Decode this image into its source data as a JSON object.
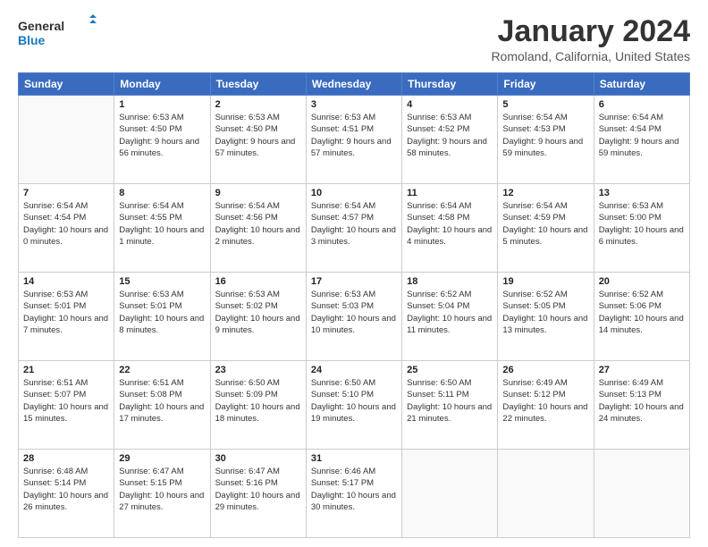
{
  "logo": {
    "general": "General",
    "blue": "Blue"
  },
  "header": {
    "title": "January 2024",
    "subtitle": "Romoland, California, United States"
  },
  "weekdays": [
    "Sunday",
    "Monday",
    "Tuesday",
    "Wednesday",
    "Thursday",
    "Friday",
    "Saturday"
  ],
  "weeks": [
    [
      {
        "day": "",
        "sunrise": "",
        "sunset": "",
        "daylight": ""
      },
      {
        "day": "1",
        "sunrise": "Sunrise: 6:53 AM",
        "sunset": "Sunset: 4:50 PM",
        "daylight": "Daylight: 9 hours and 56 minutes."
      },
      {
        "day": "2",
        "sunrise": "Sunrise: 6:53 AM",
        "sunset": "Sunset: 4:50 PM",
        "daylight": "Daylight: 9 hours and 57 minutes."
      },
      {
        "day": "3",
        "sunrise": "Sunrise: 6:53 AM",
        "sunset": "Sunset: 4:51 PM",
        "daylight": "Daylight: 9 hours and 57 minutes."
      },
      {
        "day": "4",
        "sunrise": "Sunrise: 6:53 AM",
        "sunset": "Sunset: 4:52 PM",
        "daylight": "Daylight: 9 hours and 58 minutes."
      },
      {
        "day": "5",
        "sunrise": "Sunrise: 6:54 AM",
        "sunset": "Sunset: 4:53 PM",
        "daylight": "Daylight: 9 hours and 59 minutes."
      },
      {
        "day": "6",
        "sunrise": "Sunrise: 6:54 AM",
        "sunset": "Sunset: 4:54 PM",
        "daylight": "Daylight: 9 hours and 59 minutes."
      }
    ],
    [
      {
        "day": "7",
        "sunrise": "Sunrise: 6:54 AM",
        "sunset": "Sunset: 4:54 PM",
        "daylight": "Daylight: 10 hours and 0 minutes."
      },
      {
        "day": "8",
        "sunrise": "Sunrise: 6:54 AM",
        "sunset": "Sunset: 4:55 PM",
        "daylight": "Daylight: 10 hours and 1 minute."
      },
      {
        "day": "9",
        "sunrise": "Sunrise: 6:54 AM",
        "sunset": "Sunset: 4:56 PM",
        "daylight": "Daylight: 10 hours and 2 minutes."
      },
      {
        "day": "10",
        "sunrise": "Sunrise: 6:54 AM",
        "sunset": "Sunset: 4:57 PM",
        "daylight": "Daylight: 10 hours and 3 minutes."
      },
      {
        "day": "11",
        "sunrise": "Sunrise: 6:54 AM",
        "sunset": "Sunset: 4:58 PM",
        "daylight": "Daylight: 10 hours and 4 minutes."
      },
      {
        "day": "12",
        "sunrise": "Sunrise: 6:54 AM",
        "sunset": "Sunset: 4:59 PM",
        "daylight": "Daylight: 10 hours and 5 minutes."
      },
      {
        "day": "13",
        "sunrise": "Sunrise: 6:53 AM",
        "sunset": "Sunset: 5:00 PM",
        "daylight": "Daylight: 10 hours and 6 minutes."
      }
    ],
    [
      {
        "day": "14",
        "sunrise": "Sunrise: 6:53 AM",
        "sunset": "Sunset: 5:01 PM",
        "daylight": "Daylight: 10 hours and 7 minutes."
      },
      {
        "day": "15",
        "sunrise": "Sunrise: 6:53 AM",
        "sunset": "Sunset: 5:01 PM",
        "daylight": "Daylight: 10 hours and 8 minutes."
      },
      {
        "day": "16",
        "sunrise": "Sunrise: 6:53 AM",
        "sunset": "Sunset: 5:02 PM",
        "daylight": "Daylight: 10 hours and 9 minutes."
      },
      {
        "day": "17",
        "sunrise": "Sunrise: 6:53 AM",
        "sunset": "Sunset: 5:03 PM",
        "daylight": "Daylight: 10 hours and 10 minutes."
      },
      {
        "day": "18",
        "sunrise": "Sunrise: 6:52 AM",
        "sunset": "Sunset: 5:04 PM",
        "daylight": "Daylight: 10 hours and 11 minutes."
      },
      {
        "day": "19",
        "sunrise": "Sunrise: 6:52 AM",
        "sunset": "Sunset: 5:05 PM",
        "daylight": "Daylight: 10 hours and 13 minutes."
      },
      {
        "day": "20",
        "sunrise": "Sunrise: 6:52 AM",
        "sunset": "Sunset: 5:06 PM",
        "daylight": "Daylight: 10 hours and 14 minutes."
      }
    ],
    [
      {
        "day": "21",
        "sunrise": "Sunrise: 6:51 AM",
        "sunset": "Sunset: 5:07 PM",
        "daylight": "Daylight: 10 hours and 15 minutes."
      },
      {
        "day": "22",
        "sunrise": "Sunrise: 6:51 AM",
        "sunset": "Sunset: 5:08 PM",
        "daylight": "Daylight: 10 hours and 17 minutes."
      },
      {
        "day": "23",
        "sunrise": "Sunrise: 6:50 AM",
        "sunset": "Sunset: 5:09 PM",
        "daylight": "Daylight: 10 hours and 18 minutes."
      },
      {
        "day": "24",
        "sunrise": "Sunrise: 6:50 AM",
        "sunset": "Sunset: 5:10 PM",
        "daylight": "Daylight: 10 hours and 19 minutes."
      },
      {
        "day": "25",
        "sunrise": "Sunrise: 6:50 AM",
        "sunset": "Sunset: 5:11 PM",
        "daylight": "Daylight: 10 hours and 21 minutes."
      },
      {
        "day": "26",
        "sunrise": "Sunrise: 6:49 AM",
        "sunset": "Sunset: 5:12 PM",
        "daylight": "Daylight: 10 hours and 22 minutes."
      },
      {
        "day": "27",
        "sunrise": "Sunrise: 6:49 AM",
        "sunset": "Sunset: 5:13 PM",
        "daylight": "Daylight: 10 hours and 24 minutes."
      }
    ],
    [
      {
        "day": "28",
        "sunrise": "Sunrise: 6:48 AM",
        "sunset": "Sunset: 5:14 PM",
        "daylight": "Daylight: 10 hours and 26 minutes."
      },
      {
        "day": "29",
        "sunrise": "Sunrise: 6:47 AM",
        "sunset": "Sunset: 5:15 PM",
        "daylight": "Daylight: 10 hours and 27 minutes."
      },
      {
        "day": "30",
        "sunrise": "Sunrise: 6:47 AM",
        "sunset": "Sunset: 5:16 PM",
        "daylight": "Daylight: 10 hours and 29 minutes."
      },
      {
        "day": "31",
        "sunrise": "Sunrise: 6:46 AM",
        "sunset": "Sunset: 5:17 PM",
        "daylight": "Daylight: 10 hours and 30 minutes."
      },
      {
        "day": "",
        "sunrise": "",
        "sunset": "",
        "daylight": ""
      },
      {
        "day": "",
        "sunrise": "",
        "sunset": "",
        "daylight": ""
      },
      {
        "day": "",
        "sunrise": "",
        "sunset": "",
        "daylight": ""
      }
    ]
  ]
}
